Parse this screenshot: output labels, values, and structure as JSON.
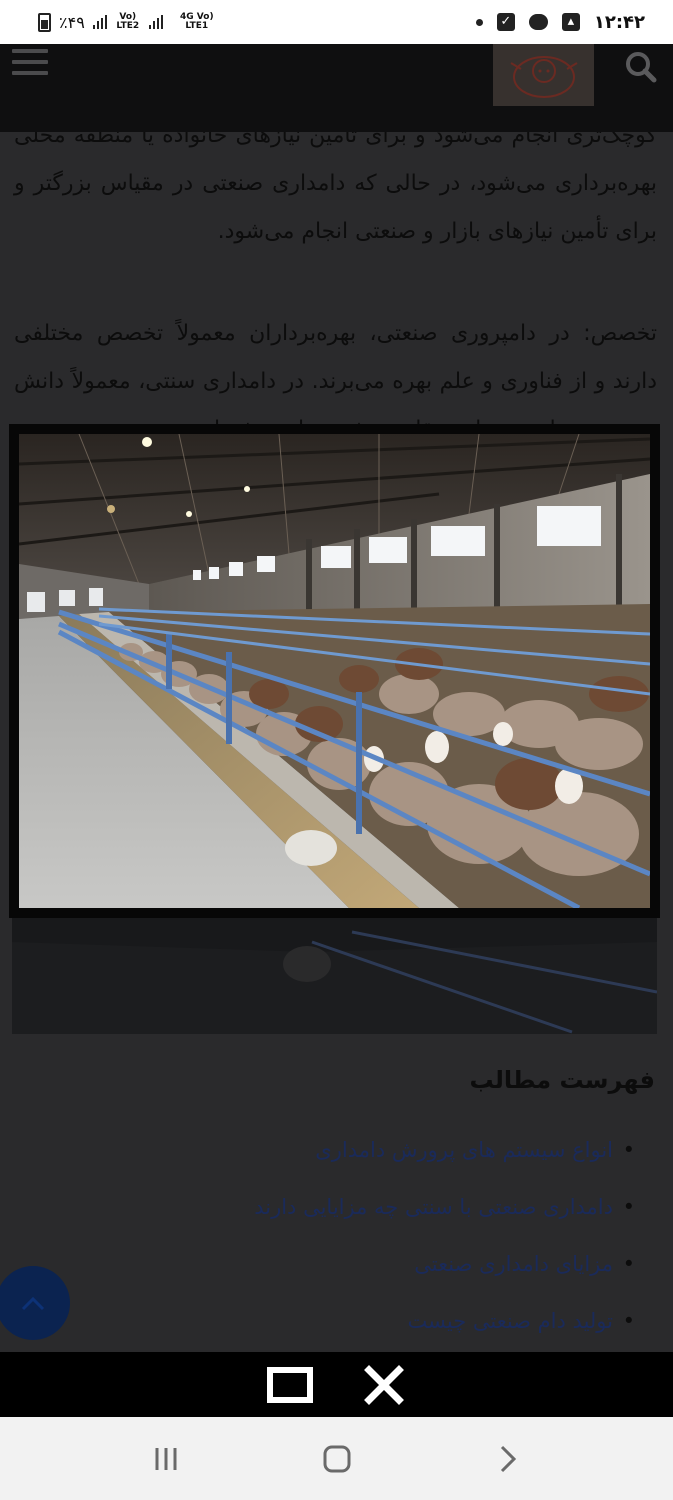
{
  "status_bar": {
    "battery": "٪۴۹",
    "network1": "Vo) LTE2",
    "network2": "4G Vo) LTE1",
    "time": "۱۲:۴۲"
  },
  "article": {
    "para1": "کوچک‌تری انجام می‌شود و برای تأمین نیازهای خانواده یا منطقه محلی بهره‌برداری می‌شود، در حالی که دامداری صنعتی در مقیاس بزرگتر و برای تأمین نیازهای بازار و صنعتی انجام می‌شود.",
    "para2": "تخصص: در دامپروری صنعتی، بهره‌برداران معمولاً تخصص مختلفی دارند و از فناوری و علم بهره می‌برند. در دامداری سنتی، معمولاً دانش و تجربه نسل به نسل منتقل می‌شود و از روش‌های",
    "toc_title": "فهرست مطالب",
    "toc_items": [
      "انواع سیستم های پرورش دامداری",
      "دامداری صنعتی با سنتی چه مزایایی دارند",
      "مزایای دامداری صنعتی",
      "تولید دام صنعتی چیست"
    ]
  },
  "icons": {
    "menu": "hamburger-icon",
    "search": "search-icon",
    "logo": "sheep-logo",
    "scroll_top": "chevron-up-icon",
    "viewer_expand": "square-icon",
    "viewer_close": "close-icon",
    "nav_recents": "recents-icon",
    "nav_home": "home-icon",
    "nav_back": "back-icon"
  },
  "colors": {
    "overlay_bg": "#2a2a2c",
    "scroll_top_button": "#0b2350",
    "link_text": "#1a2a5a",
    "viewer_bar": "#000000",
    "nav_bar": "#f2f2f2"
  }
}
